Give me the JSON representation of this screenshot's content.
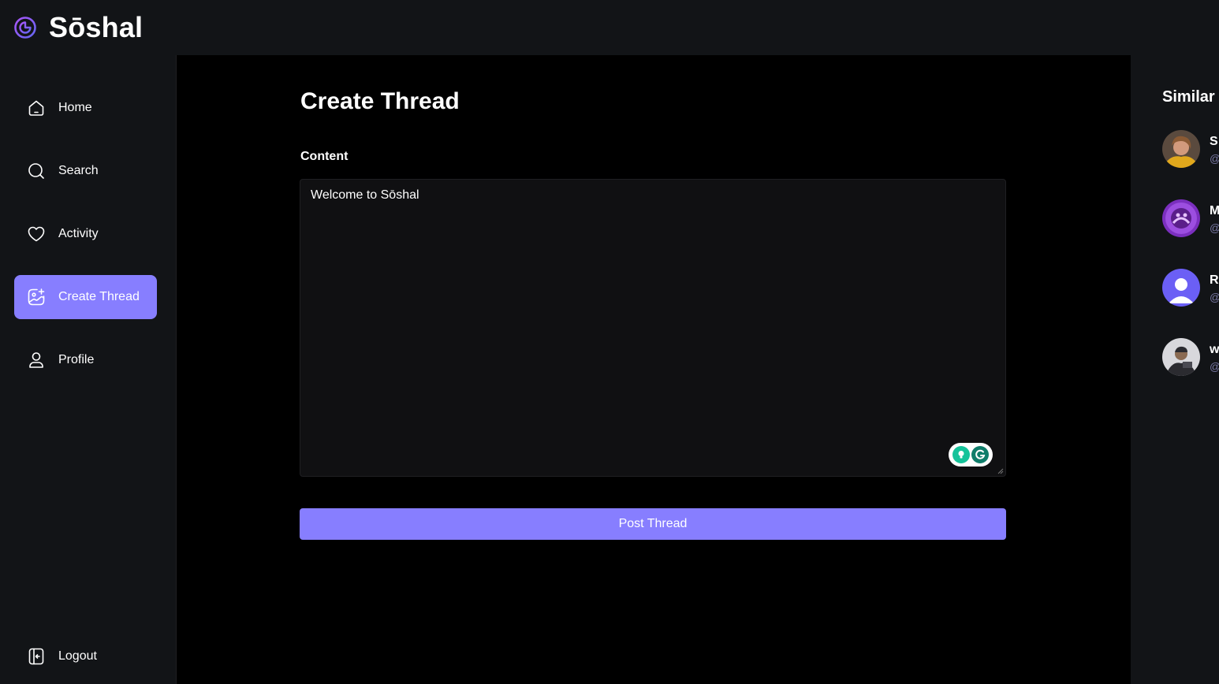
{
  "app": {
    "brand": "Sōshal"
  },
  "colors": {
    "accent": "#877eff",
    "background": "#000000",
    "panel": "#121417",
    "muted": "#7878a3"
  },
  "sidebar": {
    "items": [
      {
        "label": "Home",
        "icon": "home-icon",
        "active": false
      },
      {
        "label": "Search",
        "icon": "search-icon",
        "active": false
      },
      {
        "label": "Activity",
        "icon": "heart-icon",
        "active": false
      },
      {
        "label": "Create Thread",
        "icon": "gallery-add-icon",
        "active": true
      },
      {
        "label": "Profile",
        "icon": "user-icon",
        "active": false
      }
    ],
    "logout": {
      "label": "Logout",
      "icon": "logout-icon"
    }
  },
  "main": {
    "title": "Create Thread",
    "content_label": "Content",
    "content_value": "Welcome to Sōshal",
    "submit_label": "Post Thread"
  },
  "rightbar": {
    "title": "Similar",
    "users": [
      {
        "name": "S",
        "handle": "@"
      },
      {
        "name": "M",
        "handle": "@"
      },
      {
        "name": "R",
        "handle": "@"
      },
      {
        "name": "w",
        "handle": "@"
      }
    ]
  }
}
